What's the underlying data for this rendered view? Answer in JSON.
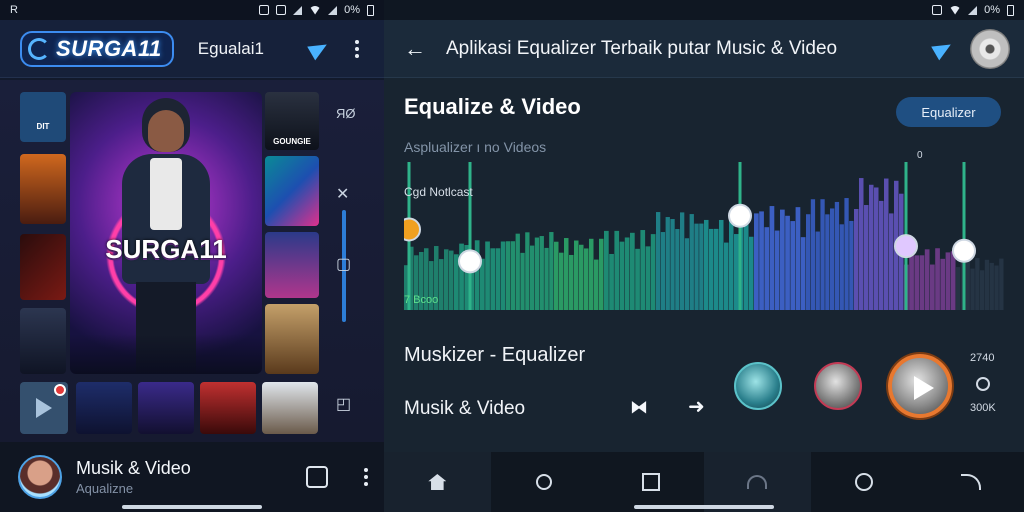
{
  "left": {
    "status": {
      "time_icon": "R",
      "battery_text": "0%"
    },
    "header": {
      "logo_text": "SURGA11",
      "title": "Egualai1",
      "send_icon": "send-icon",
      "menu_icon": "more-vert-icon"
    },
    "gallery": {
      "hero_title": "SURGA11",
      "thumbs": [
        {
          "label": "DIT"
        },
        {
          "label": "GOUNGIE"
        },
        {
          "label": ""
        },
        {
          "label": ""
        },
        {
          "label": ""
        },
        {
          "label": ""
        }
      ],
      "rail_top_label": "ЯØ"
    },
    "now_playing": {
      "title": "Musik & Video",
      "subtitle": "Aqualizne"
    }
  },
  "right": {
    "status": {
      "battery_text": "0%"
    },
    "header": {
      "title": "Aplikasi Equalizer Terbaik putar Music & Video"
    },
    "eq": {
      "title": "Equalize & Video",
      "button_label": "Equalizer",
      "subtitle": "Asplualizer ı no Videos",
      "band_label": "Cgd Notlcast",
      "freq_label": "7 Bcoo",
      "zero_label": "0",
      "slider_levels": [
        0.53,
        0.32,
        0.62,
        0.42,
        0.39
      ]
    },
    "player": {
      "title": "Muskizer - Equalizer",
      "subtitle": "Musik & Video",
      "stat_top": "2740",
      "stat_bottom": "300K"
    }
  }
}
